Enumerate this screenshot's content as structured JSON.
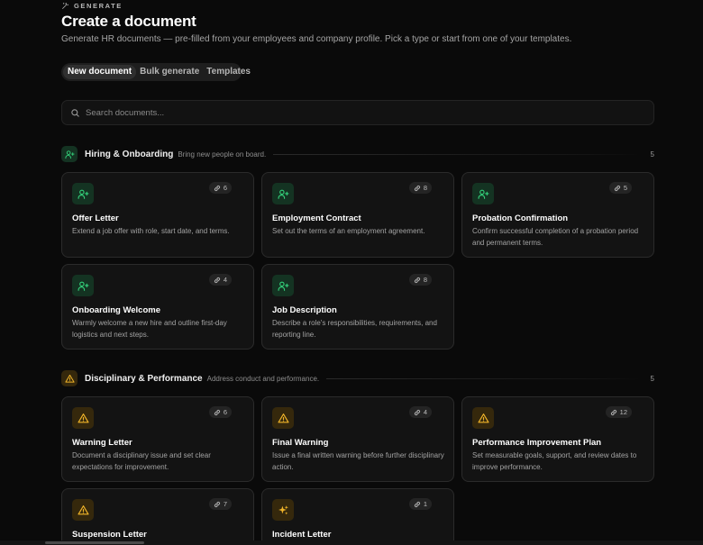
{
  "header": {
    "eyebrow": "GENERATE",
    "title": "Create a document",
    "subtitle": "Generate HR documents — pre-filled from your employees and company profile. Pick a type or start from one of your templates."
  },
  "tabs": [
    {
      "label": "New document",
      "active": true
    },
    {
      "label": "Bulk generate",
      "active": false
    },
    {
      "label": "Templates",
      "active": false
    }
  ],
  "search": {
    "placeholder": "Search documents..."
  },
  "sections": [
    {
      "title": "Hiring & Onboarding",
      "description": "Bring new people on board.",
      "count": "5",
      "icon": "user-plus-icon",
      "accent": "#34d27b",
      "cards": [
        {
          "title": "Offer Letter",
          "description": "Extend a job offer with role, start date, and terms.",
          "count": "6",
          "icon": "user-plus-icon"
        },
        {
          "title": "Employment Contract",
          "description": "Set out the terms of an employment agreement.",
          "count": "8",
          "icon": "user-plus-icon"
        },
        {
          "title": "Probation Confirmation",
          "description": "Confirm successful completion of a probation period and permanent terms.",
          "count": "5",
          "icon": "user-plus-icon"
        },
        {
          "title": "Onboarding Welcome",
          "description": "Warmly welcome a new hire and outline first-day logistics and next steps.",
          "count": "4",
          "icon": "user-plus-icon"
        },
        {
          "title": "Job Description",
          "description": "Describe a role's responsibilities, requirements, and reporting line.",
          "count": "8",
          "icon": "user-plus-icon"
        }
      ]
    },
    {
      "title": "Disciplinary & Performance",
      "description": "Address conduct and performance.",
      "count": "5",
      "icon": "warning-icon",
      "accent": "#f0b429",
      "cards": [
        {
          "title": "Warning Letter",
          "description": "Document a disciplinary issue and set clear expectations for improvement.",
          "count": "6",
          "icon": "warning-icon"
        },
        {
          "title": "Final Warning",
          "description": "Issue a final written warning before further disciplinary action.",
          "count": "4",
          "icon": "warning-icon"
        },
        {
          "title": "Performance Improvement Plan",
          "description": "Set measurable goals, support, and review dates to improve performance.",
          "count": "12",
          "icon": "warning-icon"
        },
        {
          "title": "Suspension Letter",
          "description": "",
          "count": "7",
          "icon": "warning-icon"
        },
        {
          "title": "Incident Letter",
          "description": "",
          "count": "1",
          "icon": "sparkles-icon"
        }
      ]
    }
  ]
}
